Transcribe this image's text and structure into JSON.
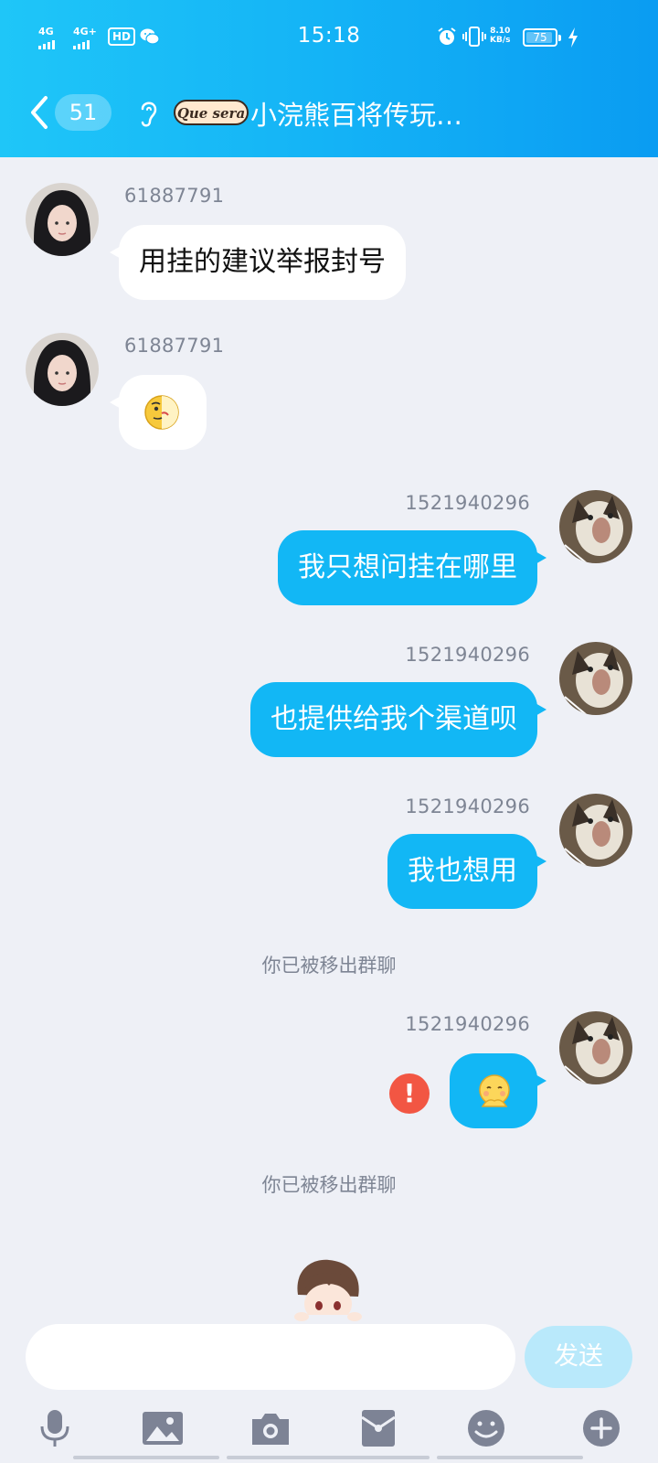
{
  "status_bar": {
    "signal1": "4G",
    "signal2": "4G+",
    "hd": "HD",
    "time": "15:18",
    "net_speed_value": "8.10",
    "net_speed_unit": "KB/s",
    "battery": "75"
  },
  "header": {
    "unread_count": "51",
    "logo_text": "Que sera",
    "title": "小浣熊百将传玩…"
  },
  "messages": [
    {
      "sender": "61887791",
      "text": "用挂的建议举报封号"
    },
    {
      "sender": "61887791",
      "emoji": "slyface-emoji"
    },
    {
      "sender": "1521940296",
      "text": "我只想问挂在哪里"
    },
    {
      "sender": "1521940296",
      "text": "也提供给我个渠道呗"
    },
    {
      "sender": "1521940296",
      "text": "我也想用"
    },
    {
      "system": "你已被移出群聊"
    },
    {
      "sender": "1521940296",
      "emoji": "shy-emoji",
      "error": "!"
    },
    {
      "system": "你已被移出群聊"
    }
  ],
  "composer": {
    "input_value": "",
    "send_label": "发送"
  },
  "toolbar": [
    "microphone-icon",
    "image-icon",
    "camera-icon",
    "red-packet-icon",
    "emoji-icon",
    "plus-icon"
  ],
  "colors": {
    "header_start": "#1fc6f8",
    "header_end": "#0a9cf2",
    "out_bubble": "#12b7f5",
    "background": "#eef0f6",
    "error": "#f25643",
    "send_disabled": "#b9e9fb"
  }
}
